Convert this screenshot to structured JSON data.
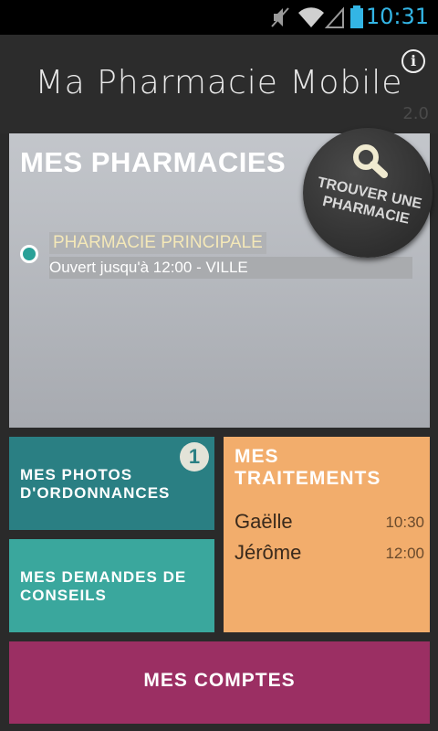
{
  "statusbar": {
    "time": "10:31"
  },
  "header": {
    "title": "Ma Pharmacie Mobile",
    "version": "2.0"
  },
  "pharmacies": {
    "title": "MES PHARMACIES",
    "selected": {
      "name": "PHARMACIE PRINCIPALE",
      "info": "Ouvert jusqu'à 12:00 - VILLE"
    },
    "find_button_label": "TROUVER UNE PHARMACIE"
  },
  "tiles": {
    "photos": {
      "label": "MES PHOTOS D'ORDONNANCES",
      "badge": "1"
    },
    "conseils": {
      "label": "MES DEMANDES DE CONSEILS"
    },
    "traitements": {
      "label": "MES TRAITEMENTS",
      "items": [
        {
          "name": "Gaëlle",
          "time": "10:30"
        },
        {
          "name": "Jérôme",
          "time": "12:00"
        }
      ]
    },
    "comptes": {
      "label": "MES COMPTES"
    }
  },
  "colors": {
    "accent": "#33b5e5",
    "photos_tile": "#2a7f83",
    "conseils_tile": "#3aa79d",
    "traitements_tile": "#f2ad6c",
    "comptes_tile": "#9b2f63"
  }
}
